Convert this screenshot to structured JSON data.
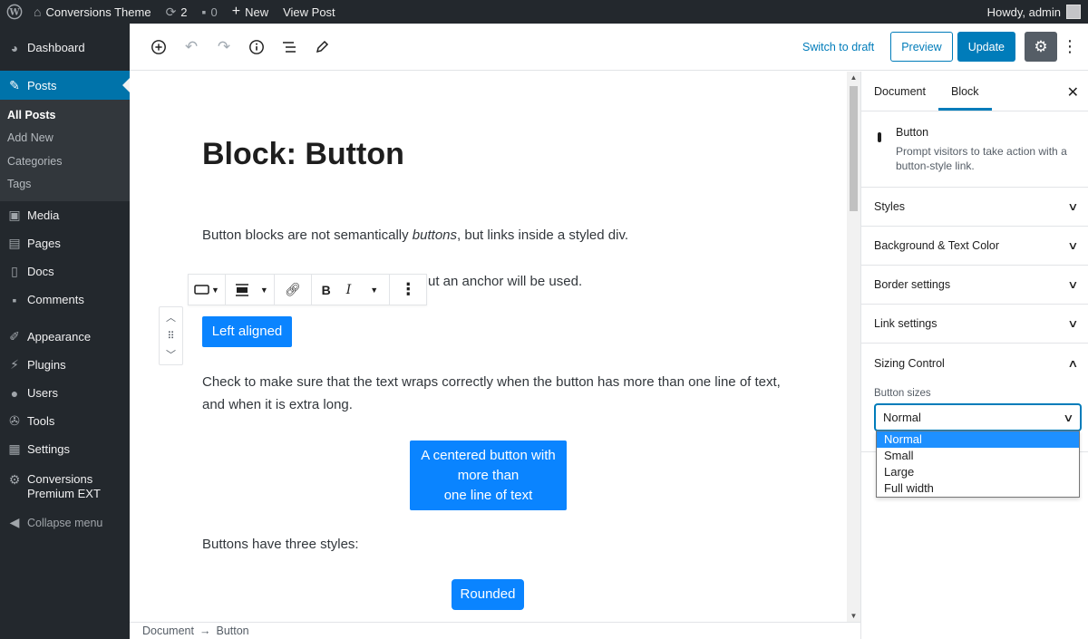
{
  "admin_bar": {
    "site_name": "Conversions Theme",
    "updates_count": "2",
    "comments_count": "0",
    "new_label": "New",
    "view_post_label": "View Post",
    "greeting": "Howdy, admin"
  },
  "sidebar": {
    "dashboard": "Dashboard",
    "posts": "Posts",
    "posts_submenu": [
      "All Posts",
      "Add New",
      "Categories",
      "Tags"
    ],
    "media": "Media",
    "pages": "Pages",
    "docs": "Docs",
    "comments": "Comments",
    "appearance": "Appearance",
    "plugins": "Plugins",
    "users": "Users",
    "tools": "Tools",
    "settings": "Settings",
    "conversions_line1": "Conversions",
    "conversions_line2": "Premium EXT",
    "collapse": "Collapse menu"
  },
  "header": {
    "switch_to_draft": "Switch to draft",
    "preview": "Preview",
    "update": "Update"
  },
  "content": {
    "title": "Block: Button",
    "para1_pre": "Button blocks are not semantically ",
    "para1_em": "buttons",
    "para1_post": ", but links inside a styled div.",
    "para2_visible": "ut an anchor will be used.",
    "left_button": "Left aligned",
    "para3": "Check to make sure that the text wraps correctly when the button has more than one line of text, and when it is extra long.",
    "centered_line1": "A centered button with",
    "centered_line2": "more than",
    "centered_line3": "one line of text",
    "para4": "Buttons have three styles:",
    "rounded_button": "Rounded"
  },
  "footer": {
    "crumb1": "Document",
    "separator": "→",
    "crumb2": "Button"
  },
  "panel": {
    "tab_document": "Document",
    "tab_block": "Block",
    "block_name": "Button",
    "block_desc": "Prompt visitors to take action with a button-style link.",
    "sections": [
      "Styles",
      "Background & Text Color",
      "Border settings",
      "Link settings"
    ],
    "sizing_title": "Sizing Control",
    "field_label": "Button sizes",
    "selected_size": "Normal",
    "size_options": [
      "Normal",
      "Small",
      "Large",
      "Full width"
    ]
  },
  "colors": {
    "accent": "#007cba",
    "button_blue": "#0a84ff",
    "admin_dark": "#23282d"
  }
}
